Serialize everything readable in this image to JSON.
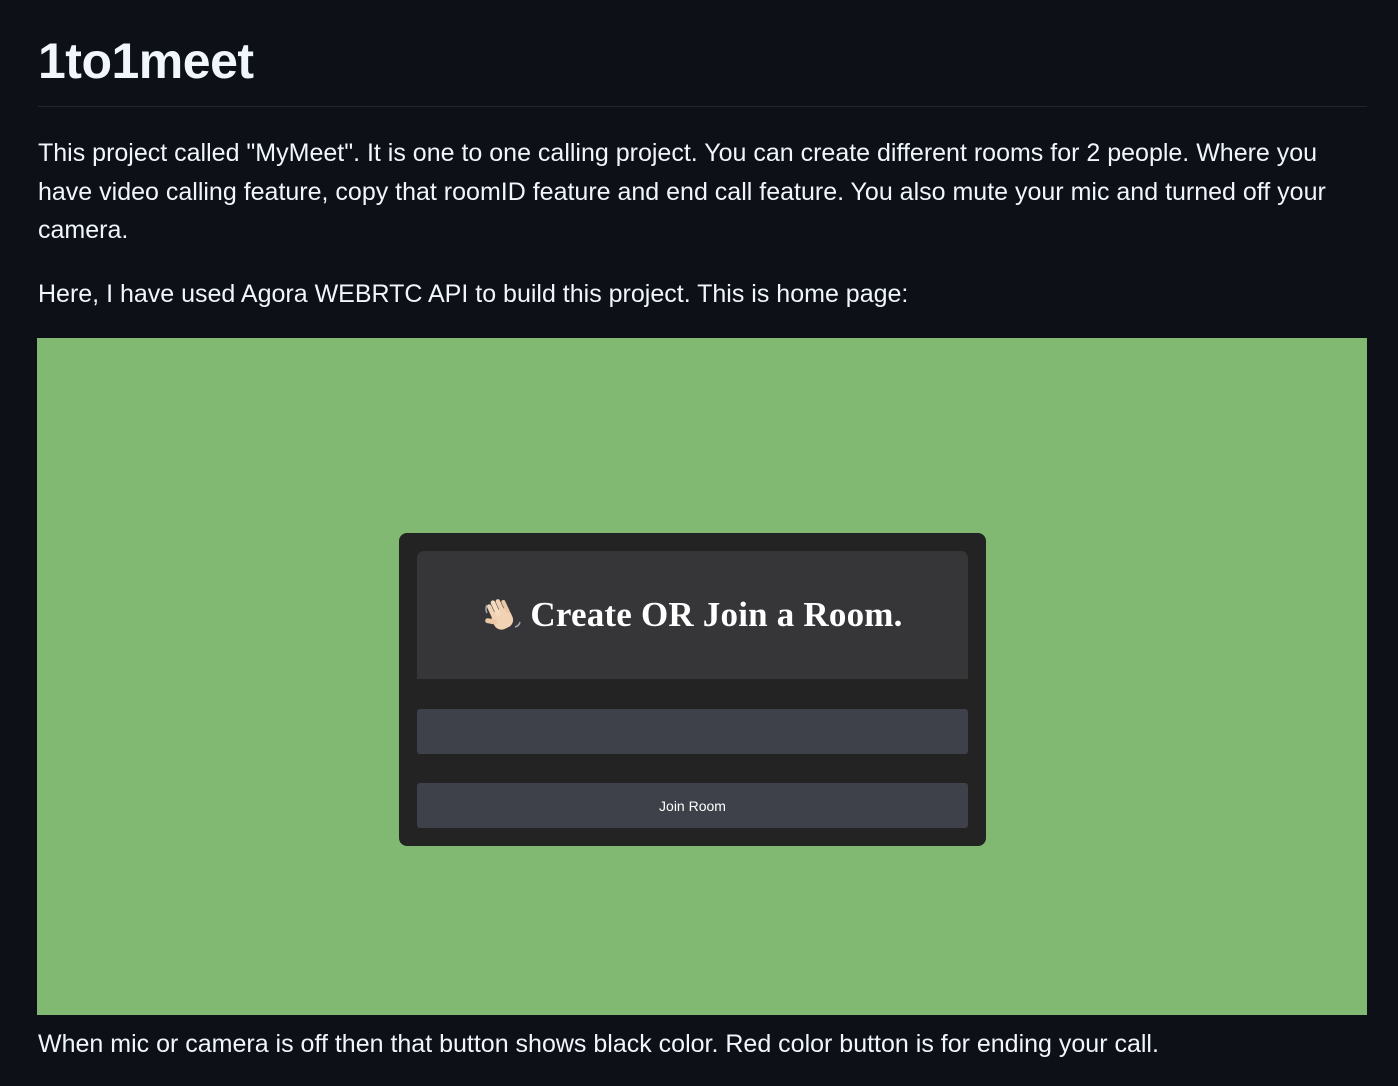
{
  "readme": {
    "title": "1to1meet",
    "paragraphs": [
      "This project called \"MyMeet\". It is one to one calling project. You can create different rooms for 2 people. Where you have video calling feature, copy that roomID feature and end call feature. You also mute your mic and turned off your camera.",
      "Here, I have used Agora WEBRTC API to build this project. This is home page:",
      "When mic or camera is off then that button shows black color. Red color button is for ending your call."
    ]
  },
  "screenshot": {
    "background_color": "#81b972",
    "card": {
      "header_icon": "waving-hand-icon",
      "title": "Create OR Join a Room.",
      "room_input": {
        "value": "",
        "placeholder": ""
      },
      "join_button_label": "Join Room"
    }
  },
  "colors": {
    "page_background": "#0d1117",
    "text": "#f0f6fc",
    "card_background": "#232323",
    "card_header": "#363639",
    "control_background": "#3e414a"
  }
}
